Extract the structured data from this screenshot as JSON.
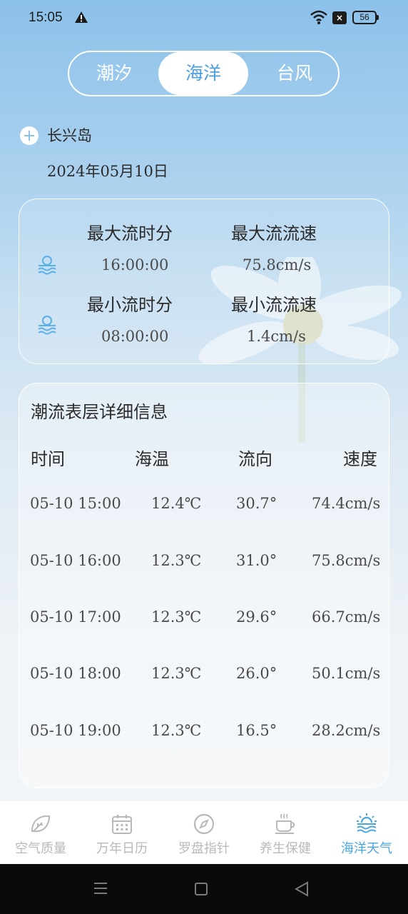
{
  "status_bar": {
    "time": "15:05",
    "battery": "56"
  },
  "tabs": [
    {
      "label": "潮汐"
    },
    {
      "label": "海洋"
    },
    {
      "label": "台风"
    }
  ],
  "location": {
    "name": "长兴岛",
    "date": "2024年05月10日"
  },
  "summary": {
    "max_time_label": "最大流时分",
    "max_speed_label": "最大流流速",
    "max_time": "16:00:00",
    "max_speed": "75.8cm/s",
    "min_time_label": "最小流时分",
    "min_speed_label": "最小流流速",
    "min_time": "08:00:00",
    "min_speed": "1.4cm/s"
  },
  "detail": {
    "title": "潮流表层详细信息",
    "headers": [
      "时间",
      "海温",
      "流向",
      "速度"
    ],
    "rows": [
      {
        "time": "05-10 15:00",
        "temp": "12.4℃",
        "direction": "30.7°",
        "speed": "74.4cm/s"
      },
      {
        "time": "05-10 16:00",
        "temp": "12.3℃",
        "direction": "31.0°",
        "speed": "75.8cm/s"
      },
      {
        "time": "05-10 17:00",
        "temp": "12.3℃",
        "direction": "29.6°",
        "speed": "66.7cm/s"
      },
      {
        "time": "05-10 18:00",
        "temp": "12.3℃",
        "direction": "26.0°",
        "speed": "50.1cm/s"
      },
      {
        "time": "05-10 19:00",
        "temp": "12.3℃",
        "direction": "16.5°",
        "speed": "28.2cm/s"
      }
    ]
  },
  "bottom_nav": [
    {
      "label": "空气质量",
      "icon": "leaf-icon"
    },
    {
      "label": "万年日历",
      "icon": "calendar-icon"
    },
    {
      "label": "罗盘指针",
      "icon": "compass-icon"
    },
    {
      "label": "养生保健",
      "icon": "tea-cup-icon"
    },
    {
      "label": "海洋天气",
      "icon": "sun-waves-icon"
    }
  ],
  "colors": {
    "accent": "#4aa5e0",
    "inactive": "#b9b9b9",
    "sky_top": "#8cc1ea"
  }
}
